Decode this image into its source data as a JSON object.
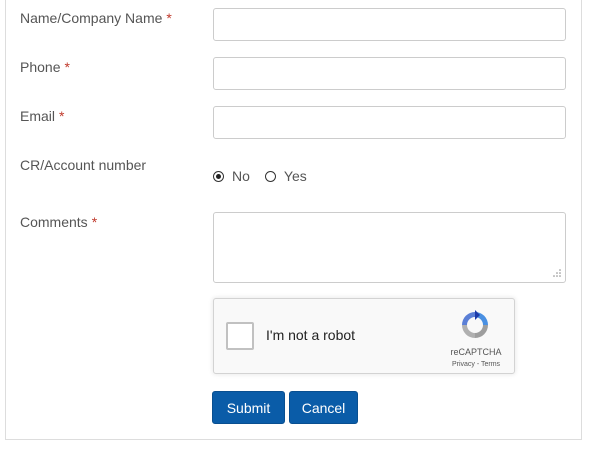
{
  "form": {
    "name_label": "Name/Company Name",
    "phone_label": "Phone",
    "email_label": "Email",
    "account_label": "CR/Account number",
    "comments_label": "Comments",
    "required_marker": "*",
    "name_value": "",
    "phone_value": "",
    "email_value": "",
    "comments_value": "",
    "account_options": [
      {
        "label": "No",
        "selected": true
      },
      {
        "label": "Yes",
        "selected": false
      }
    ]
  },
  "captcha": {
    "checkbox_label": "I'm not a robot",
    "brand": "reCAPTCHA",
    "links": "Privacy - Terms",
    "checked": false
  },
  "actions": {
    "submit_label": "Submit",
    "cancel_label": "Cancel"
  },
  "colors": {
    "button_bg": "#0a5ca8",
    "required": "#c0392b"
  }
}
